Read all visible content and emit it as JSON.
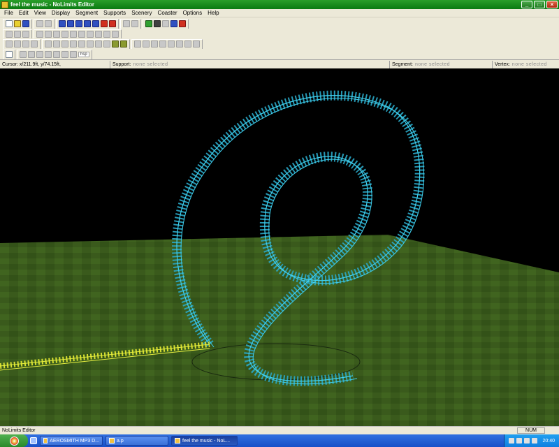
{
  "window": {
    "title": "feel the music - NoLimits Editor"
  },
  "menu": {
    "items": [
      "File",
      "Edit",
      "View",
      "Display",
      "Segment",
      "Supports",
      "Scenery",
      "Coaster",
      "Options",
      "Help"
    ]
  },
  "toolbar4": {
    "label": "hsp"
  },
  "statusbar": {
    "cursor": "Cursor: x/211.9ft, y/74.15ft,",
    "support_label": "Support:",
    "support_value": "none selected",
    "segment_label": "Segment:",
    "segment_value": "none selected",
    "vertex_label": "Vertex:",
    "vertex_value": "none selected"
  },
  "scene": {
    "sky_color": "#000000",
    "ground_color": "#3a5a1c",
    "track_color": "#30c8e0",
    "track_highlight_color": "#d8e030"
  },
  "app_status": {
    "text": "NoLimits Editor",
    "num": "NUM"
  },
  "taskbar": {
    "buttons": [
      "AEROSMITH MP3 D...",
      "a.p",
      "feel the music - NoL..."
    ],
    "clock": "20:40"
  }
}
